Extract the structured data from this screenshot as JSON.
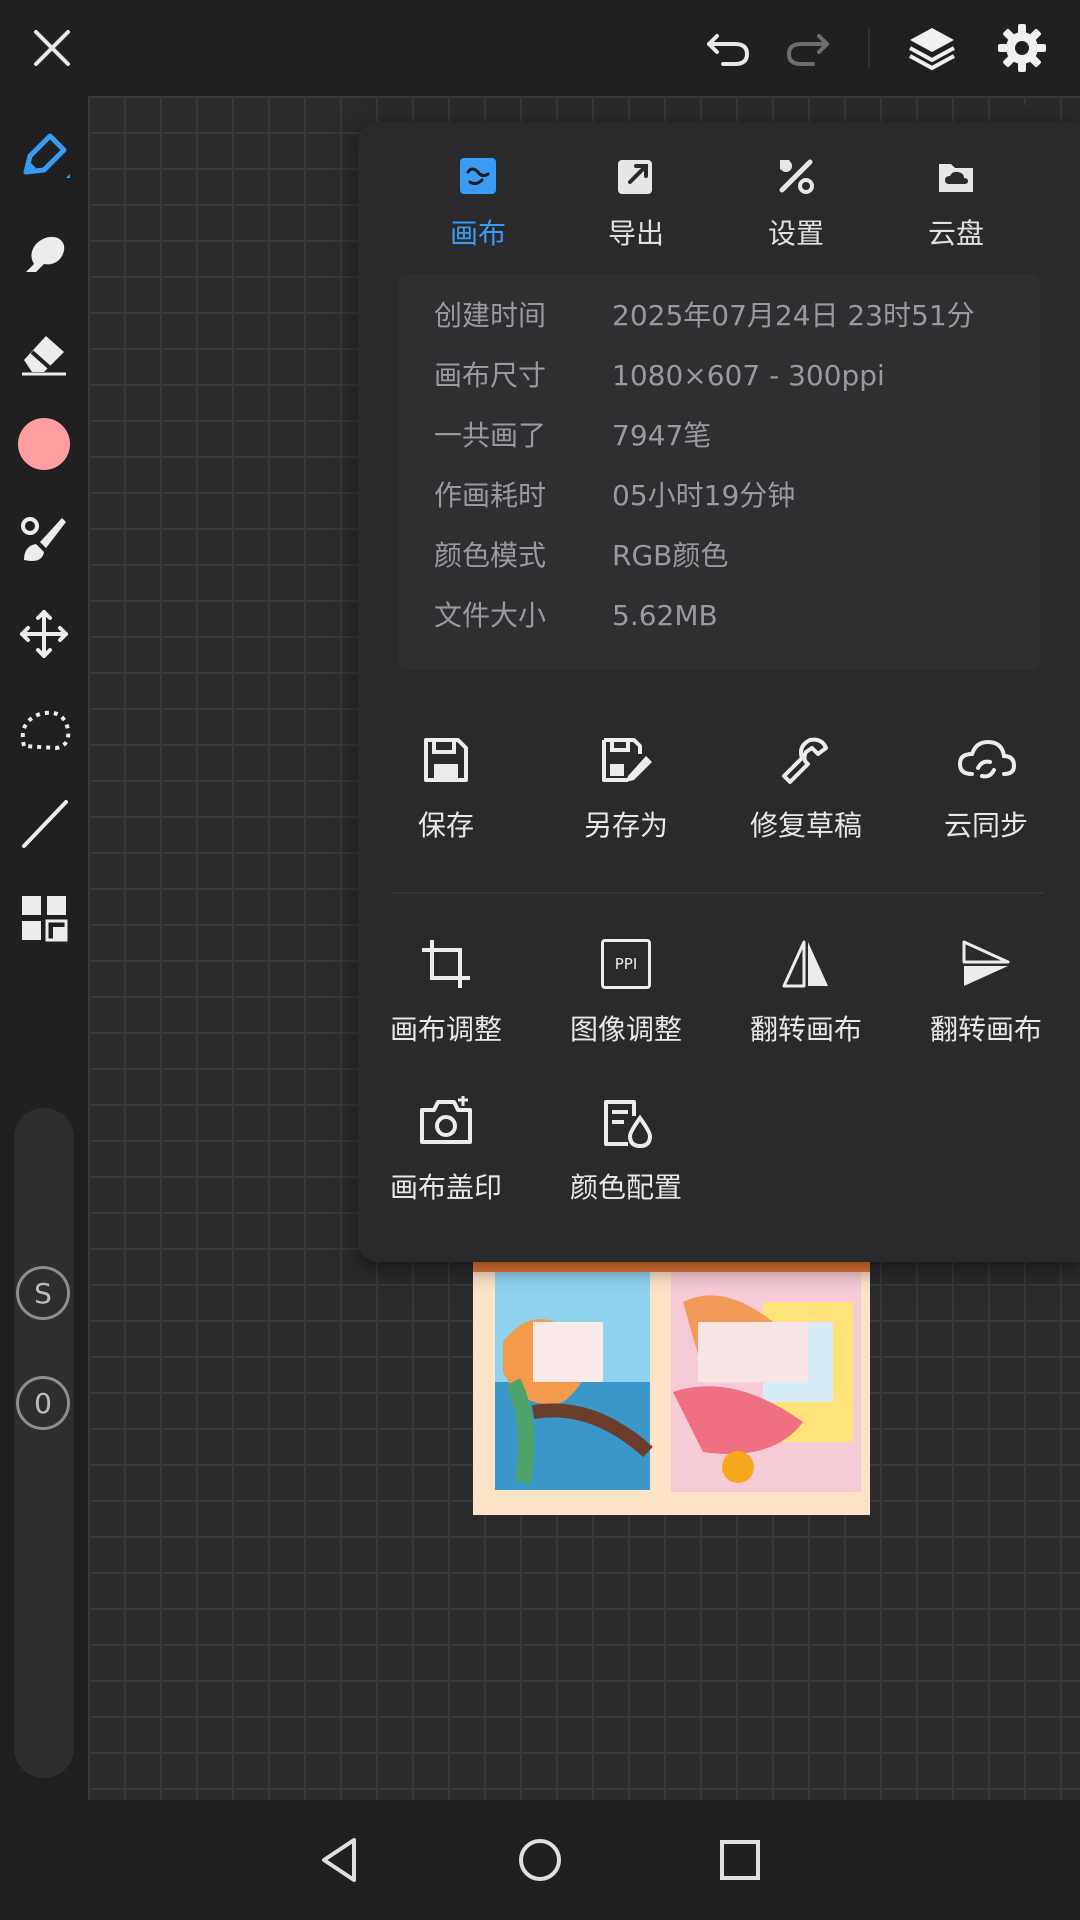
{
  "toolbar": {
    "close_icon": "close-icon",
    "undo_icon": "undo-icon",
    "redo_icon": "redo-icon",
    "layers_icon": "layers-icon",
    "settings_icon": "gear-icon"
  },
  "sidebar": {
    "tools": [
      "pen-icon",
      "smudge-icon",
      "eraser-icon",
      "color-swatch",
      "brush-icon",
      "move-icon",
      "lasso-icon",
      "line-icon",
      "grid-icon"
    ],
    "color": "#ff9ea0",
    "buttons": {
      "s_label": "S",
      "zero_label": "0"
    }
  },
  "panel": {
    "tabs": [
      {
        "label": "画布",
        "icon": "canvas-icon",
        "active": true
      },
      {
        "label": "导出",
        "icon": "export-icon",
        "active": false
      },
      {
        "label": "设置",
        "icon": "tools-icon",
        "active": false
      },
      {
        "label": "云盘",
        "icon": "cloud-drive-icon",
        "active": false
      }
    ],
    "info": [
      {
        "key": "创建时间",
        "value": "2025年07月24日 23时51分"
      },
      {
        "key": "画布尺寸",
        "value": "1080×607 - 300ppi"
      },
      {
        "key": "一共画了",
        "value": "7947笔"
      },
      {
        "key": "作画耗时",
        "value": "05小时19分钟"
      },
      {
        "key": "颜色模式",
        "value": "RGB颜色"
      },
      {
        "key": "文件大小",
        "value": "5.62MB"
      }
    ],
    "actions_row1": [
      "保存",
      "另存为",
      "修复草稿",
      "云同步"
    ],
    "actions_row2": [
      "画布调整",
      "图像调整",
      "翻转画布",
      "翻转画布"
    ],
    "actions_row3": [
      "画布盖印",
      "颜色配置"
    ],
    "ppi_icon_text": "PPI"
  },
  "colors": {
    "accent": "#3a9bf5",
    "panel_bg": "#2a2a2c",
    "app_bg": "#1f1f20"
  },
  "navbar": [
    "back-icon",
    "home-icon",
    "recents-icon"
  ]
}
